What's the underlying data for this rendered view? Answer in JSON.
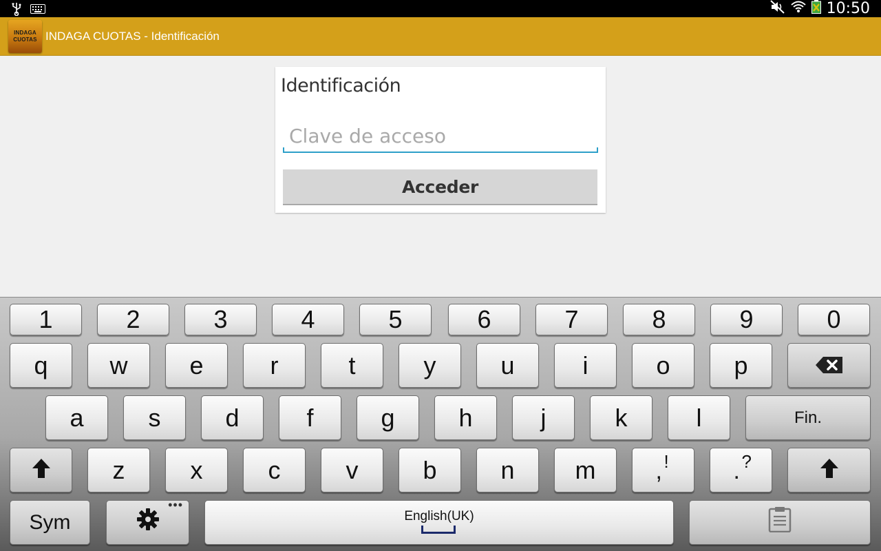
{
  "statusbar": {
    "time": "10:50"
  },
  "app": {
    "logo_line1": "INDAGA",
    "logo_line2": "CUOTAS",
    "title": "INDAGA CUOTAS - Identificación"
  },
  "dialog": {
    "title": "Identificación",
    "password_placeholder": "Clave de acceso",
    "password_value": "",
    "submit_label": "Acceder"
  },
  "keyboard": {
    "row_numbers": [
      "1",
      "2",
      "3",
      "4",
      "5",
      "6",
      "7",
      "8",
      "9",
      "0"
    ],
    "row_q": [
      "q",
      "w",
      "e",
      "r",
      "t",
      "y",
      "u",
      "i",
      "o",
      "p"
    ],
    "row_a": [
      "a",
      "s",
      "d",
      "f",
      "g",
      "h",
      "j",
      "k",
      "l"
    ],
    "enter_label": "Fin.",
    "row_z": [
      "z",
      "x",
      "c",
      "v",
      "b",
      "n",
      "m"
    ],
    "comma_main": ",",
    "comma_alt": "!",
    "period_main": ".",
    "period_alt": "?",
    "sym_label": "Sym",
    "space_label": "English(UK)",
    "accent": "#d4a01a"
  }
}
